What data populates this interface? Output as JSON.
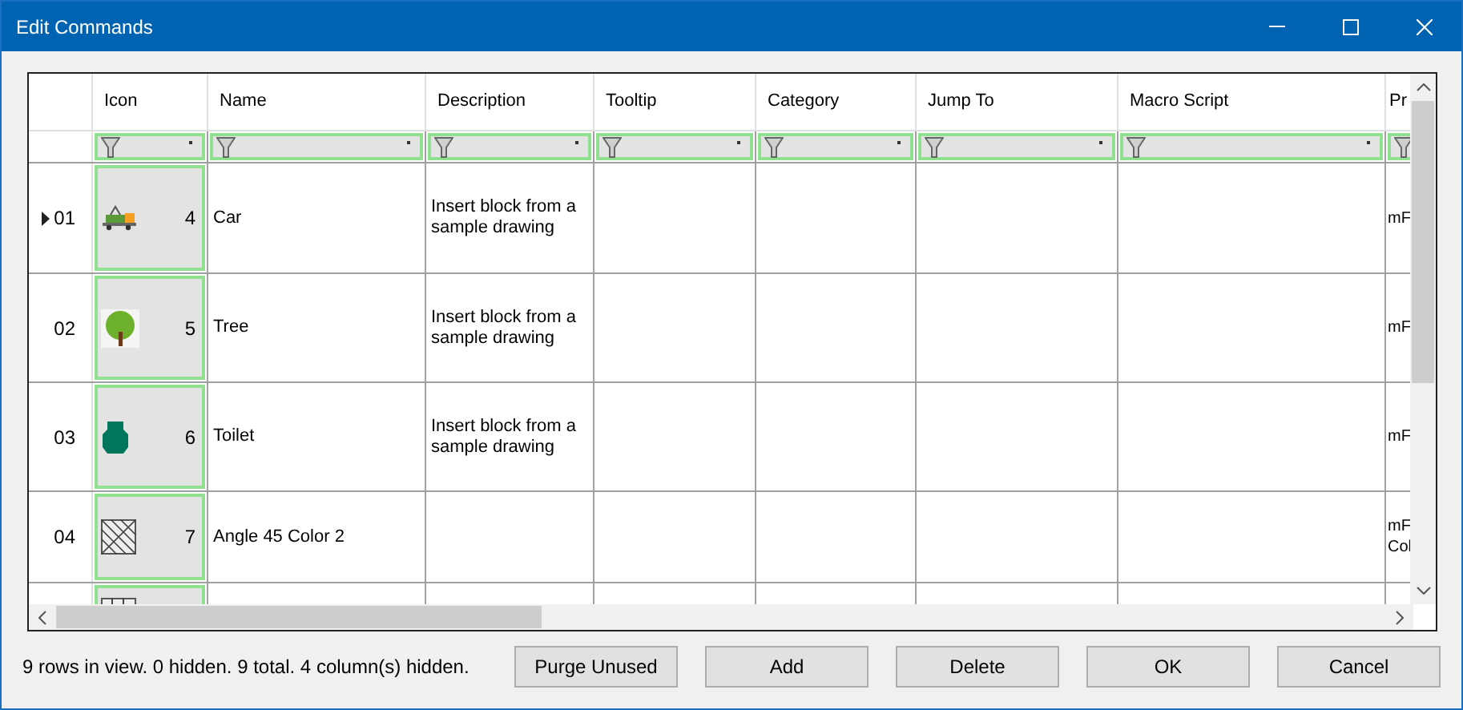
{
  "window": {
    "title": "Edit Commands"
  },
  "table": {
    "columns": [
      "Icon",
      "Name",
      "Description",
      "Tooltip",
      "Category",
      "Jump To",
      "Macro Script",
      "Pr"
    ],
    "rows": [
      {
        "number": "01",
        "selected": true,
        "icon": {
          "kind": "truck",
          "count": "4"
        },
        "name": "Car",
        "description": "Insert block from a sample drawing",
        "column_8": "mF"
      },
      {
        "number": "02",
        "selected": false,
        "icon": {
          "kind": "tree",
          "count": "5"
        },
        "name": "Tree",
        "description": "Insert block from a sample drawing",
        "column_8": "mF"
      },
      {
        "number": "03",
        "selected": false,
        "icon": {
          "kind": "toilet",
          "count": "6"
        },
        "name": "Toilet",
        "description": "Insert block from a sample drawing",
        "column_8": "mF"
      },
      {
        "number": "04",
        "selected": false,
        "icon": {
          "kind": "hatch",
          "count": "7"
        },
        "name": "Angle 45 Color 2",
        "description": "",
        "column_8": "mF Col"
      }
    ]
  },
  "status": "9 rows in view. 0 hidden. 9 total. 4 column(s) hidden.",
  "buttons": [
    "Purge Unused",
    "Add",
    "Delete",
    "OK",
    "Cancel"
  ]
}
